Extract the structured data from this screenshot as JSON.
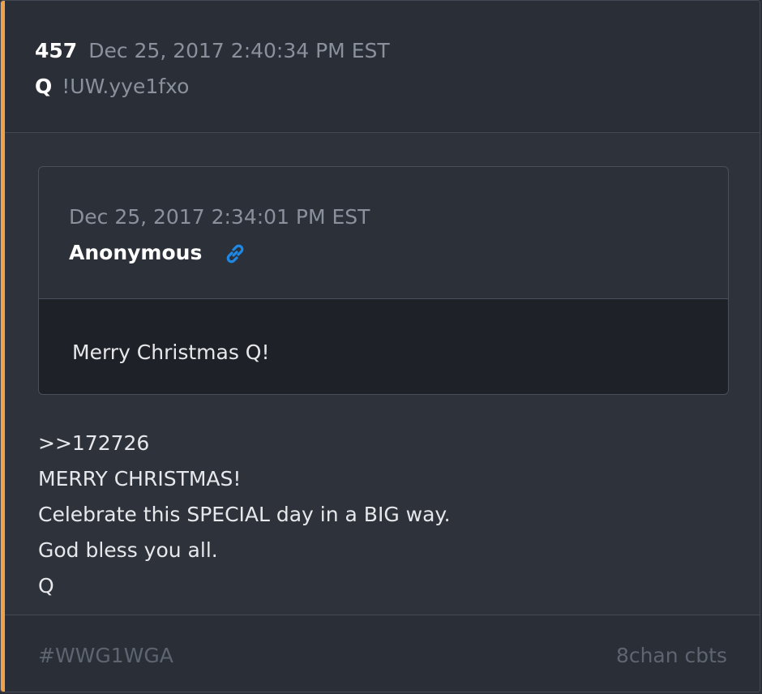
{
  "post": {
    "number": "457",
    "date": "Dec 25, 2017 2:40:34 PM EST",
    "author": "Q",
    "tripcode": "!UW.yye1fxo"
  },
  "quoted_post": {
    "date": "Dec 25, 2017 2:34:01 PM EST",
    "author": "Anonymous",
    "link_icon": "link-icon",
    "text": "Merry Christmas Q!"
  },
  "message": {
    "lines": [
      ">>172726",
      "MERRY CHRISTMAS!",
      "Celebrate this SPECIAL day in a BIG way.",
      "God bless you all.",
      "Q"
    ]
  },
  "footer": {
    "tag": "#WWG1WGA",
    "source": "8chan cbts"
  },
  "colors": {
    "accent": "#f0a24a",
    "link": "#1e88e5",
    "background": "#2e323b"
  }
}
